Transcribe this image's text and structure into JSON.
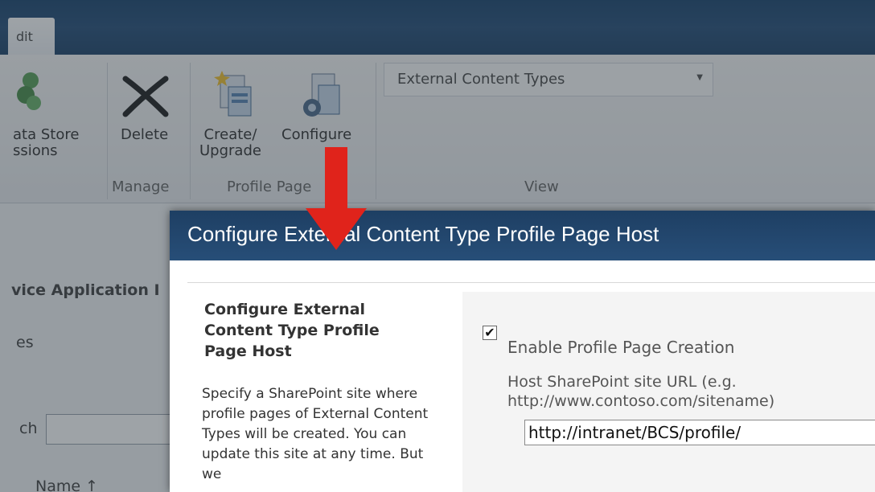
{
  "ribbon": {
    "tab_label": "dit",
    "buttons": {
      "data_store_line1": "ata Store",
      "data_store_line2": "ssions",
      "delete": "Delete",
      "create_line1": "Create/",
      "create_line2": "Upgrade",
      "configure": "Configure"
    },
    "groups": {
      "manage": "Manage",
      "profile_page": "Profile Page",
      "view": "View"
    },
    "view_select": "External Content Types"
  },
  "background": {
    "service_heading": "vice Application I",
    "label_es": "es",
    "label_ch": "ch",
    "label_name": "Name ↑"
  },
  "dialog": {
    "title": "Configure External Content Type Profile Page Host",
    "section_title": "Configure External Content Type Profile Page Host",
    "section_description": "Specify a SharePoint site where profile pages of External Content Types will be created. You can update this site at any time. But we",
    "checkbox_label": "Enable Profile Page Creation",
    "checkbox_checked": true,
    "checkbox_glyph": "✔",
    "url_label": "Host SharePoint site URL (e.g. http://www.contoso.com/sitename)",
    "url_value": "http://intranet/BCS/profile/"
  },
  "colors": {
    "title_bar": "#274e78",
    "arrow": "#e0231b"
  }
}
